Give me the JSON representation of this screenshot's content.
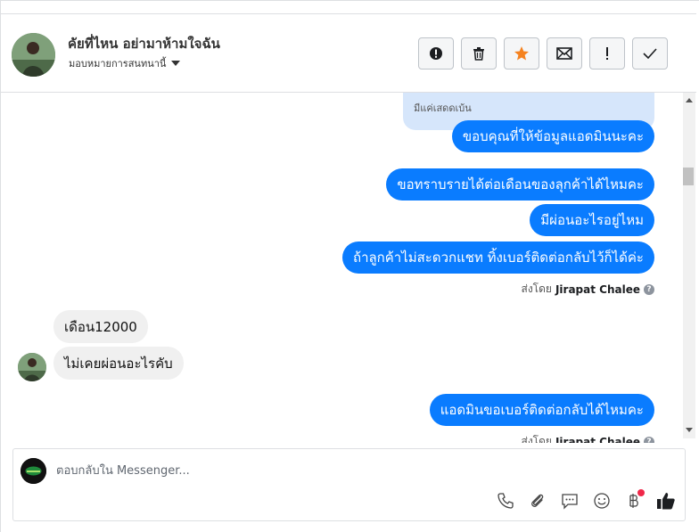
{
  "header": {
    "name": "คัยที่ไหน อย่ามาห้ามใจฉัน",
    "assign_label": "มอบหมายการสนทนานี้"
  },
  "actions": [
    {
      "icon": "alert-circle-icon",
      "label": "spam"
    },
    {
      "icon": "trash-icon",
      "label": "delete"
    },
    {
      "icon": "star-icon",
      "label": "star"
    },
    {
      "icon": "envelope-icon",
      "label": "unread"
    },
    {
      "icon": "exclamation-icon",
      "label": "follow up"
    },
    {
      "icon": "checkmark-icon",
      "label": "done"
    }
  ],
  "thread": {
    "reply_quote": "มีแค่เสดดเบ้น",
    "messages_out_1": [
      "ขอบคุณที่ให้ข้อมูลแอดมินนะคะ"
    ],
    "messages_out_2": [
      "ขอทราบรายได้ต่อเดือนของลุกค้าได้ไหมคะ",
      "มีผ่อนอะไรอยู่ไหม",
      "ถ้าลูกค้าไม่สะดวกแชท ทิ้งเบอร์ติดต่อกลับไว้ก็ได้ค่ะ"
    ],
    "sent_by_prefix": "ส่งโดย",
    "sent_by_name": "Jirapat Chalee",
    "messages_in": [
      "เดือน12000",
      "ไม่เคยผ่อนอะไรคับ"
    ],
    "messages_out_3": [
      "แอดมินขอเบอร์ติดต่อกลับได้ไหมคะ"
    ]
  },
  "composer": {
    "placeholder": "ตอบกลับใน Messenger..."
  },
  "colors": {
    "accent": "#0a7cff",
    "incoming_bubble": "#f0f0f0",
    "quote_bubble": "#d6e6fb",
    "star": "#f5821f",
    "notify_dot": "#f02849"
  }
}
